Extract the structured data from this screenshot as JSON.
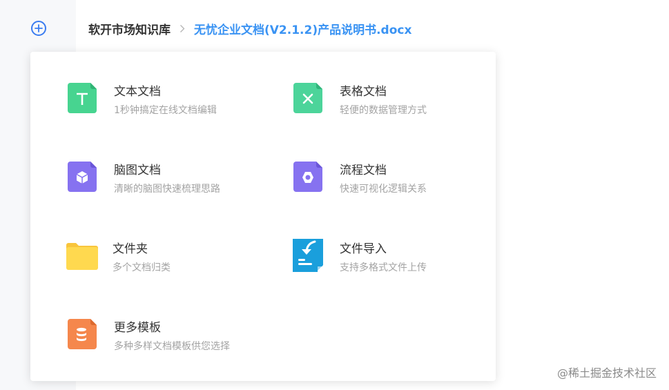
{
  "breadcrumb": {
    "root": "软开市场知识库",
    "current": "无忧企业文档(V2.1.2)产品说明书.docx"
  },
  "menu": [
    {
      "title": "文本文档",
      "desc": "1秒钟搞定在线文档编辑",
      "icon": "text-doc-icon",
      "color": "#47d490"
    },
    {
      "title": "表格文档",
      "desc": "轻便的数据管理方式",
      "icon": "sheet-doc-icon",
      "color": "#4cd49a"
    },
    {
      "title": "脑图文档",
      "desc": "清晰的脑图快速梳理思路",
      "icon": "mindmap-doc-icon",
      "color": "#8672f0"
    },
    {
      "title": "流程文档",
      "desc": "快速可视化逻辑关系",
      "icon": "flow-doc-icon",
      "color": "#8672f0"
    },
    {
      "title": "文件夹",
      "desc": "多个文档归类",
      "icon": "folder-icon",
      "color": "#ffd44f"
    },
    {
      "title": "文件导入",
      "desc": "支持多格式文件上传",
      "icon": "import-file-icon",
      "color": "#1a9fdc"
    },
    {
      "title": "更多模板",
      "desc": "多种多样文档模板供您选择",
      "icon": "template-icon",
      "color": "#f5874c"
    }
  ],
  "watermark": "@稀土掘金技术社区",
  "colors": {
    "accent": "#3a93f3",
    "add_button": "#3a7cf0"
  }
}
